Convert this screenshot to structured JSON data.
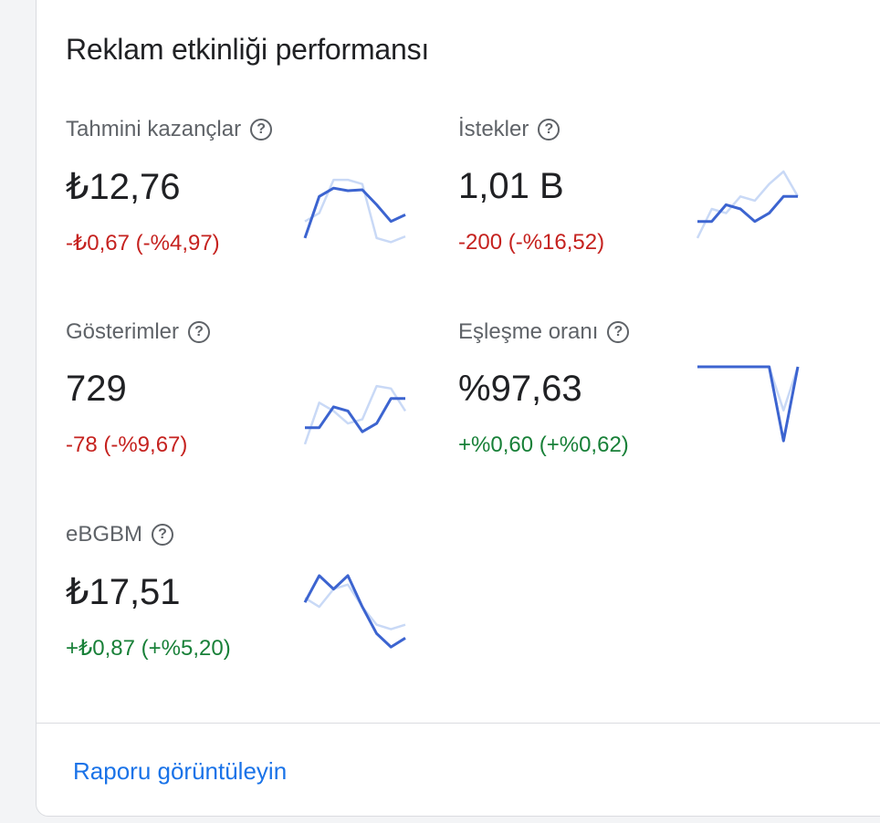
{
  "card": {
    "title": "Reklam etkinliği performansı",
    "report_link": "Raporu görüntüleyin"
  },
  "colors": {
    "current_line": "#3c64d0",
    "previous_line": "#c9d9f6",
    "negative": "#c5221f",
    "positive": "#188038",
    "link": "#1a73e8"
  },
  "metrics": [
    {
      "label": "Tahmini kazançlar",
      "help_icon": "help-circle-icon",
      "value": "₺12,76",
      "change": "-₺0,67 (-%4,97)",
      "trend": "negative",
      "chart_data": {
        "type": "line",
        "series": [
          {
            "values": [
              3,
              4,
              8,
              8,
              7.5,
              1,
              0.5,
              1.2
            ]
          },
          {
            "values": [
              1,
              6,
              7,
              6.7,
              6.8,
              5,
              3,
              3.8
            ]
          }
        ]
      }
    },
    {
      "label": "İstekler",
      "help_icon": "help-circle-icon",
      "value": "1,01 B",
      "change": "-200 (-%16,52)",
      "trend": "negative",
      "chart_data": {
        "type": "line",
        "series": [
          {
            "values": [
              1,
              4.5,
              4,
              6,
              5.5,
              7.5,
              9,
              6
            ]
          },
          {
            "values": [
              3,
              3,
              5,
              4.5,
              3,
              4,
              6,
              6
            ]
          }
        ]
      }
    },
    {
      "label": "Gösterimler",
      "help_icon": "help-circle-icon",
      "value": "729",
      "change": "-78 (-%9,67)",
      "trend": "negative",
      "chart_data": {
        "type": "line",
        "series": [
          {
            "values": [
              1,
              6,
              5,
              3.5,
              4,
              8,
              7.7,
              5
            ]
          },
          {
            "values": [
              3,
              3,
              5.5,
              5,
              2.5,
              3.5,
              6.5,
              6.5
            ]
          }
        ]
      }
    },
    {
      "label": "Eşleşme oranı",
      "help_icon": "help-circle-icon",
      "value": "%97,63",
      "change": "+%0,60 (+%0,62)",
      "trend": "positive",
      "chart_data": {
        "type": "line",
        "series": [
          {
            "values": [
              9,
              9,
              9,
              9,
              9,
              9,
              4,
              9
            ]
          },
          {
            "values": [
              9,
              9,
              9,
              9,
              9,
              9,
              0.5,
              9
            ]
          }
        ]
      }
    },
    {
      "label": "eBGBM",
      "help_icon": "help-circle-icon",
      "value": "₺17,51",
      "change": "+₺0,87 (+%5,20)",
      "trend": "positive",
      "chart_data": {
        "type": "line",
        "series": [
          {
            "values": [
              6,
              5,
              7,
              7.5,
              5,
              3,
              2.5,
              3
            ]
          },
          {
            "values": [
              5.5,
              8.5,
              7,
              8.5,
              5,
              2,
              0.5,
              1.5
            ]
          }
        ]
      }
    }
  ]
}
